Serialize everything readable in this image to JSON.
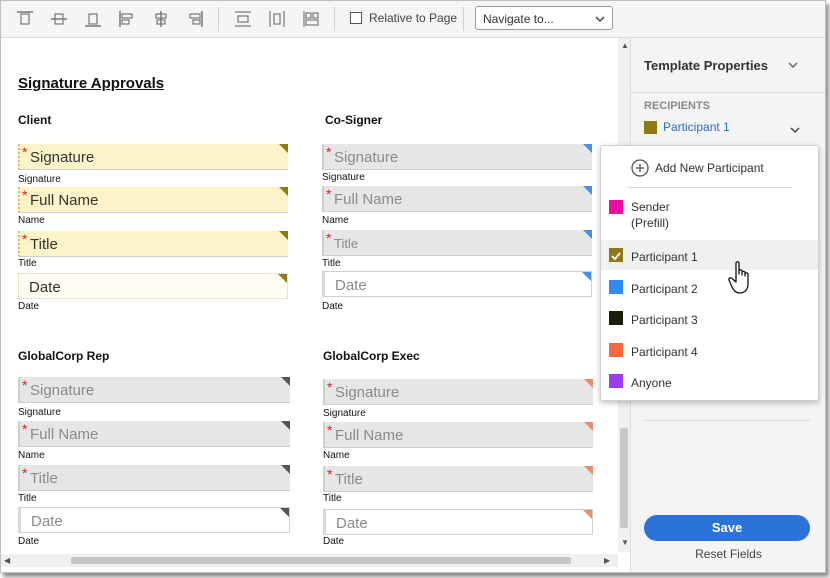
{
  "toolbar": {
    "icons": [
      "align-top-icon",
      "align-vertical-center-icon",
      "align-bottom-icon",
      "align-left-icon",
      "align-horizontal-center-icon",
      "align-right-icon",
      "distribute-vertical-icon",
      "distribute-horizontal-icon",
      "match-size-icon"
    ],
    "relative_to_page_label": "Relative to Page",
    "relative_to_page_checked": false,
    "navigate_placeholder": "Navigate to..."
  },
  "document": {
    "title": "Signature Approvals",
    "sections": [
      {
        "title": "Client",
        "participant_color": "#8b7a16",
        "fields": [
          {
            "placeholder": "Signature",
            "label": "Signature",
            "required": true
          },
          {
            "placeholder": "Full Name",
            "label": "Name",
            "required": true
          },
          {
            "placeholder": "Title",
            "label": "Title",
            "required": true
          },
          {
            "placeholder": "Date",
            "label": "Date",
            "required": false
          }
        ]
      },
      {
        "title": "Co-Signer",
        "participant_color": "#4a90e2",
        "fields": [
          {
            "placeholder": "Signature",
            "label": "Signature",
            "required": true
          },
          {
            "placeholder": "Full Name",
            "label": "Name",
            "required": true
          },
          {
            "placeholder": "Title",
            "label": "Title",
            "required": true
          },
          {
            "placeholder": "Date",
            "label": "Date",
            "required": false
          }
        ]
      },
      {
        "title": "GlobalCorp Rep",
        "participant_color": "#555555",
        "fields": [
          {
            "placeholder": "Signature",
            "label": "Signature",
            "required": true
          },
          {
            "placeholder": "Full Name",
            "label": "Name",
            "required": true
          },
          {
            "placeholder": "Title",
            "label": "Title",
            "required": true
          },
          {
            "placeholder": "Date",
            "label": "Date",
            "required": false
          }
        ]
      },
      {
        "title": "GlobalCorp Exec",
        "participant_color": "#ef8a6a",
        "fields": [
          {
            "placeholder": "Signature",
            "label": "Signature",
            "required": true
          },
          {
            "placeholder": "Full Name",
            "label": "Name",
            "required": true
          },
          {
            "placeholder": "Title",
            "label": "Title",
            "required": true
          },
          {
            "placeholder": "Date",
            "label": "Date",
            "required": false
          }
        ]
      }
    ]
  },
  "panel": {
    "title": "Template Properties",
    "recipients_label": "RECIPIENTS",
    "selected_recipient": "Participant 1",
    "selected_color": "#8b7a16",
    "save_label": "Save",
    "reset_label": "Reset Fields"
  },
  "dropdown": {
    "add_label": "Add New Participant",
    "options": [
      {
        "line1": "Sender",
        "line2": "(Prefill)",
        "color": "#e60fa0",
        "selected": false
      },
      {
        "line1": "Participant 1",
        "line2": "",
        "color": "#8b7a16",
        "selected": true
      },
      {
        "line1": "Participant 2",
        "line2": "",
        "color": "#2f8cf5",
        "selected": false
      },
      {
        "line1": "Participant 3",
        "line2": "",
        "color": "#1d1d0c",
        "selected": false
      },
      {
        "line1": "Participant 4",
        "line2": "",
        "color": "#f56a3a",
        "selected": false
      },
      {
        "line1": "Anyone",
        "line2": "",
        "color": "#9b3cf0",
        "selected": false
      }
    ]
  }
}
